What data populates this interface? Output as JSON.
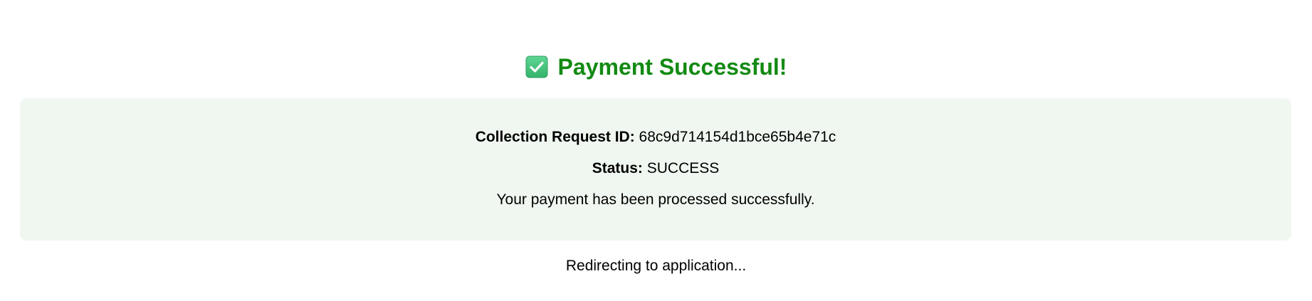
{
  "header": {
    "icon": "check-mark-button-icon",
    "title": "Payment Successful!",
    "title_color": "#138a13",
    "icon_color": "#43c27b"
  },
  "details": {
    "background": "#f0f7f0",
    "collection_request_id_label": "Collection Request ID:",
    "collection_request_id_value": "68c9d714154d1bce65b4e71c",
    "status_label": "Status:",
    "status_value": "SUCCESS",
    "message": "Your payment has been processed successfully."
  },
  "footer": {
    "redirect_text": "Redirecting to application..."
  }
}
